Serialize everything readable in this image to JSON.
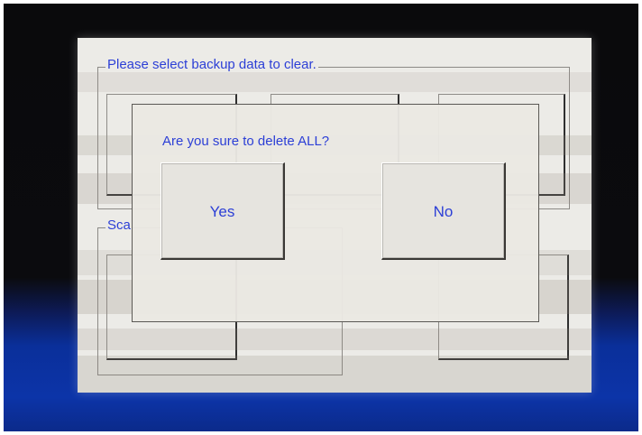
{
  "screen": {
    "group_backup": {
      "legend": "Please select backup data to clear."
    },
    "group_scan": {
      "legend": "Sca"
    }
  },
  "dialog": {
    "question": "Are you sure to delete ALL?",
    "yes_label": "Yes",
    "no_label": "No"
  },
  "colors": {
    "screen_background": "#ecebe7",
    "text_blue": "#2c3fd6",
    "bezel_dark": "#0a0a0c",
    "bezel_blue": "#0c34a8"
  }
}
